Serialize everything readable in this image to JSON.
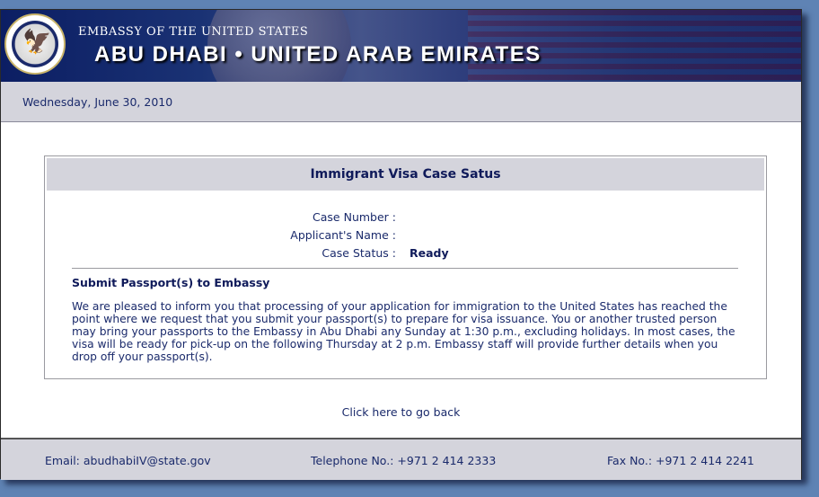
{
  "banner": {
    "subtitle": "EMBASSY OF THE UNITED STATES",
    "title": "ABU DHABI • UNITED ARAB EMIRATES",
    "seal_icon": "us-department-of-state-seal-icon"
  },
  "date": "Wednesday, June 30, 2010",
  "panel": {
    "title": "Immigrant Visa Case Satus",
    "fields": [
      {
        "label": "Case Number :",
        "value": ""
      },
      {
        "label": "Applicant's Name :",
        "value": ""
      },
      {
        "label": "Case Status :",
        "value": "Ready"
      }
    ],
    "section_title": "Submit Passport(s) to Embassy",
    "body": "We are pleased to inform you that processing of your application for immigration to the United States has reached the point where we request that you submit your passport(s) to prepare for visa issuance. You or another trusted person may bring your passports to the Embassy in Abu Dhabi any Sunday at 1:30 p.m., excluding holidays. In most cases, the visa will be ready for pick-up on the following Thursday at 2 p.m. Embassy staff will provide further details when you drop off your passport(s)."
  },
  "back_link": "Click here to go back",
  "footer": {
    "email": "Email: abudhabiIV@state.gov",
    "telephone": "Telephone No.: +971 2 414 2333",
    "fax": "Fax No.: +971 2 414 2241"
  },
  "colors": {
    "background": "#5f83b4",
    "banner": "#0c1e63",
    "text": "#1a2a6b",
    "bar": "#d4d4dc"
  }
}
